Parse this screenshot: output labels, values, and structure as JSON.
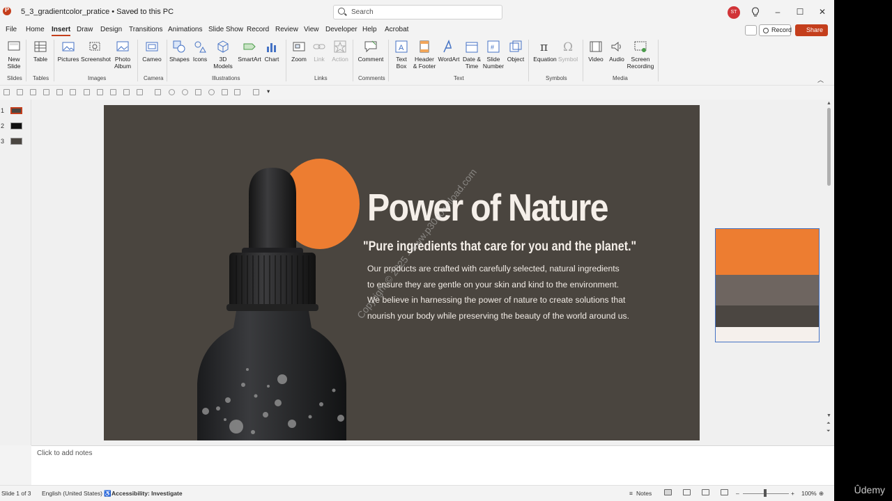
{
  "titlebar": {
    "doc_title": "5_3_gradientcolor_pratice • Saved to this PC",
    "search_placeholder": "Search",
    "avatar_initials": "ST",
    "minimize": "–",
    "maximize": "☐",
    "close": "✕"
  },
  "menu": {
    "tabs": [
      "File",
      "Home",
      "Insert",
      "Draw",
      "Design",
      "Transitions",
      "Animations",
      "Slide Show",
      "Record",
      "Review",
      "View",
      "Developer",
      "Help",
      "Acrobat"
    ],
    "active": "Insert",
    "record_label": "Record",
    "share_label": "Share"
  },
  "ribbon": {
    "new_slide": "New Slide",
    "table": "Table",
    "pictures": "Pictures",
    "screenshot": "Screenshot",
    "photo_album": "Photo Album",
    "cameo": "Cameo",
    "shapes": "Shapes",
    "icons": "Icons",
    "models3d": "3D Models",
    "smartart": "SmartArt",
    "chart": "Chart",
    "zoom": "Zoom",
    "link": "Link",
    "action": "Action",
    "comment": "Comment",
    "text_box": "Text Box",
    "header_footer": "Header & Footer",
    "wordart": "WordArt",
    "date_time": "Date & Time",
    "slide_number": "Slide Number",
    "object": "Object",
    "equation": "Equation",
    "symbol": "Symbol",
    "video": "Video",
    "audio": "Audio",
    "screen_recording": "Screen Recording",
    "groups": {
      "slides": "Slides",
      "tables": "Tables",
      "images": "Images",
      "camera": "Camera",
      "illustrations": "Illustrations",
      "links": "Links",
      "comments": "Comments",
      "text": "Text",
      "symbols": "Symbols",
      "media": "Media"
    }
  },
  "thumbnails": [
    "1",
    "2",
    "3"
  ],
  "slide": {
    "title": "Power of Nature",
    "quote": "\"Pure ingredients that care for you and the planet.\"",
    "body_lines": [
      "Our products are crafted with carefully selected, natural ingredients",
      "to ensure they are gentle on your skin and kind to the environment.",
      "We believe in harnessing the power of nature to create solutions that",
      "nourish your body while preserving the beauty of the world around us."
    ],
    "watermark": "Copyright © 2025 - www.p30download.com",
    "bg_color": "#4a453f",
    "accent_color": "#ed7d31"
  },
  "palette": {
    "colors": [
      "#ed7d31",
      "#6e6560",
      "#4b4641",
      "#f5f0ec"
    ]
  },
  "notes": {
    "placeholder": "Click to add notes"
  },
  "statusbar": {
    "slide_info": "Slide 1 of 3",
    "language": "English (United States)",
    "accessibility": "Accessibility: Investigate",
    "notes_label": "Notes",
    "zoom": "100%"
  },
  "overlay": {
    "brand": "Ûdemy"
  }
}
